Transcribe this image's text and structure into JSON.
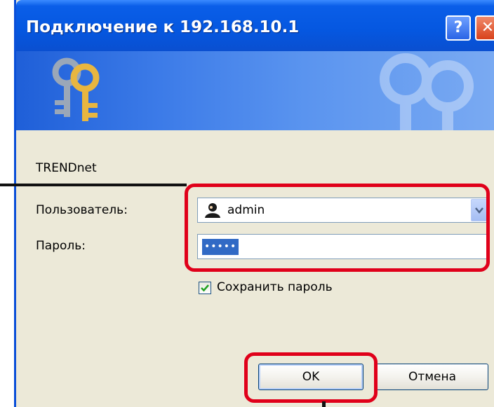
{
  "window": {
    "title": "Подключение к 192.168.10.1",
    "help_label": "?",
    "close_label": "✕"
  },
  "dialog": {
    "site_name": "TRENDnet",
    "user_label": "Пользователь:",
    "user_value": "admin",
    "password_label": "Пароль:",
    "password_value": "•••••",
    "remember_label": "Сохранить пароль",
    "remember_checked": true,
    "ok_label": "OK",
    "cancel_label": "Отмена"
  },
  "colors": {
    "title_bar": "#0557e0",
    "highlight": "#e0001a",
    "selection": "#316ac5"
  },
  "icons": [
    "keys-icon",
    "user-icon",
    "chevron-down-icon",
    "checkmark-icon"
  ]
}
